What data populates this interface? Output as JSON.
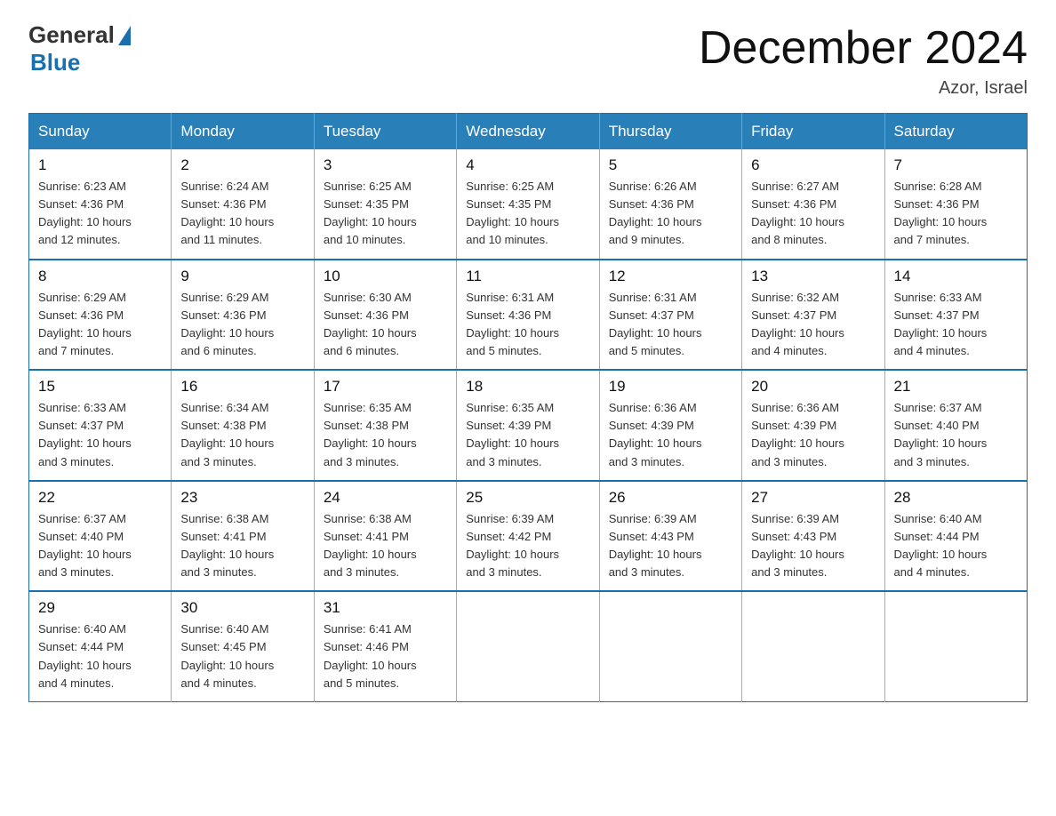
{
  "logo": {
    "text_general": "General",
    "text_blue": "Blue"
  },
  "title": "December 2024",
  "location": "Azor, Israel",
  "days_of_week": [
    "Sunday",
    "Monday",
    "Tuesday",
    "Wednesday",
    "Thursday",
    "Friday",
    "Saturday"
  ],
  "weeks": [
    [
      {
        "day": "1",
        "sunrise": "6:23 AM",
        "sunset": "4:36 PM",
        "daylight": "10 hours and 12 minutes."
      },
      {
        "day": "2",
        "sunrise": "6:24 AM",
        "sunset": "4:36 PM",
        "daylight": "10 hours and 11 minutes."
      },
      {
        "day": "3",
        "sunrise": "6:25 AM",
        "sunset": "4:35 PM",
        "daylight": "10 hours and 10 minutes."
      },
      {
        "day": "4",
        "sunrise": "6:25 AM",
        "sunset": "4:35 PM",
        "daylight": "10 hours and 10 minutes."
      },
      {
        "day": "5",
        "sunrise": "6:26 AM",
        "sunset": "4:36 PM",
        "daylight": "10 hours and 9 minutes."
      },
      {
        "day": "6",
        "sunrise": "6:27 AM",
        "sunset": "4:36 PM",
        "daylight": "10 hours and 8 minutes."
      },
      {
        "day": "7",
        "sunrise": "6:28 AM",
        "sunset": "4:36 PM",
        "daylight": "10 hours and 7 minutes."
      }
    ],
    [
      {
        "day": "8",
        "sunrise": "6:29 AM",
        "sunset": "4:36 PM",
        "daylight": "10 hours and 7 minutes."
      },
      {
        "day": "9",
        "sunrise": "6:29 AM",
        "sunset": "4:36 PM",
        "daylight": "10 hours and 6 minutes."
      },
      {
        "day": "10",
        "sunrise": "6:30 AM",
        "sunset": "4:36 PM",
        "daylight": "10 hours and 6 minutes."
      },
      {
        "day": "11",
        "sunrise": "6:31 AM",
        "sunset": "4:36 PM",
        "daylight": "10 hours and 5 minutes."
      },
      {
        "day": "12",
        "sunrise": "6:31 AM",
        "sunset": "4:37 PM",
        "daylight": "10 hours and 5 minutes."
      },
      {
        "day": "13",
        "sunrise": "6:32 AM",
        "sunset": "4:37 PM",
        "daylight": "10 hours and 4 minutes."
      },
      {
        "day": "14",
        "sunrise": "6:33 AM",
        "sunset": "4:37 PM",
        "daylight": "10 hours and 4 minutes."
      }
    ],
    [
      {
        "day": "15",
        "sunrise": "6:33 AM",
        "sunset": "4:37 PM",
        "daylight": "10 hours and 3 minutes."
      },
      {
        "day": "16",
        "sunrise": "6:34 AM",
        "sunset": "4:38 PM",
        "daylight": "10 hours and 3 minutes."
      },
      {
        "day": "17",
        "sunrise": "6:35 AM",
        "sunset": "4:38 PM",
        "daylight": "10 hours and 3 minutes."
      },
      {
        "day": "18",
        "sunrise": "6:35 AM",
        "sunset": "4:39 PM",
        "daylight": "10 hours and 3 minutes."
      },
      {
        "day": "19",
        "sunrise": "6:36 AM",
        "sunset": "4:39 PM",
        "daylight": "10 hours and 3 minutes."
      },
      {
        "day": "20",
        "sunrise": "6:36 AM",
        "sunset": "4:39 PM",
        "daylight": "10 hours and 3 minutes."
      },
      {
        "day": "21",
        "sunrise": "6:37 AM",
        "sunset": "4:40 PM",
        "daylight": "10 hours and 3 minutes."
      }
    ],
    [
      {
        "day": "22",
        "sunrise": "6:37 AM",
        "sunset": "4:40 PM",
        "daylight": "10 hours and 3 minutes."
      },
      {
        "day": "23",
        "sunrise": "6:38 AM",
        "sunset": "4:41 PM",
        "daylight": "10 hours and 3 minutes."
      },
      {
        "day": "24",
        "sunrise": "6:38 AM",
        "sunset": "4:41 PM",
        "daylight": "10 hours and 3 minutes."
      },
      {
        "day": "25",
        "sunrise": "6:39 AM",
        "sunset": "4:42 PM",
        "daylight": "10 hours and 3 minutes."
      },
      {
        "day": "26",
        "sunrise": "6:39 AM",
        "sunset": "4:43 PM",
        "daylight": "10 hours and 3 minutes."
      },
      {
        "day": "27",
        "sunrise": "6:39 AM",
        "sunset": "4:43 PM",
        "daylight": "10 hours and 3 minutes."
      },
      {
        "day": "28",
        "sunrise": "6:40 AM",
        "sunset": "4:44 PM",
        "daylight": "10 hours and 4 minutes."
      }
    ],
    [
      {
        "day": "29",
        "sunrise": "6:40 AM",
        "sunset": "4:44 PM",
        "daylight": "10 hours and 4 minutes."
      },
      {
        "day": "30",
        "sunrise": "6:40 AM",
        "sunset": "4:45 PM",
        "daylight": "10 hours and 4 minutes."
      },
      {
        "day": "31",
        "sunrise": "6:41 AM",
        "sunset": "4:46 PM",
        "daylight": "10 hours and 5 minutes."
      },
      null,
      null,
      null,
      null
    ]
  ],
  "labels": {
    "sunrise": "Sunrise:",
    "sunset": "Sunset:",
    "daylight": "Daylight:"
  }
}
